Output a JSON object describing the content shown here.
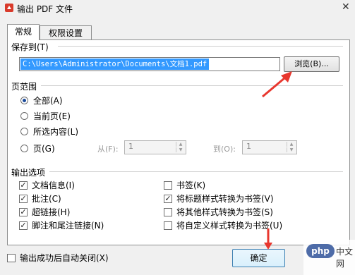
{
  "window": {
    "title": "输出 PDF 文件",
    "icon": "pdf-app-icon"
  },
  "tabs": [
    {
      "label": "常规",
      "active": true
    },
    {
      "label": "权限设置",
      "active": false
    }
  ],
  "save_to": {
    "label": "保存到(T)",
    "path": "C:\\Users\\Administrator\\Documents\\文档1.pdf",
    "browse_label": "浏览(B)..."
  },
  "page_range": {
    "label": "页范围",
    "options": [
      {
        "label": "全部(A)",
        "checked": true
      },
      {
        "label": "当前页(E)",
        "checked": false
      },
      {
        "label": "所选内容(L)",
        "checked": false
      },
      {
        "label": "页(G)",
        "checked": false
      }
    ],
    "from_label": "从(F):",
    "from_value": "1",
    "to_label": "到(O):",
    "to_value": "1"
  },
  "output_options": {
    "label": "输出选项",
    "left": [
      {
        "label": "文档信息(I)",
        "checked": true
      },
      {
        "label": "批注(C)",
        "checked": true
      },
      {
        "label": "超链接(H)",
        "checked": true
      },
      {
        "label": "脚注和尾注链接(N)",
        "checked": true
      }
    ],
    "right": [
      {
        "label": "书签(K)",
        "checked": false
      },
      {
        "label": "将标题样式转换为书签(V)",
        "checked": true
      },
      {
        "label": "将其他样式转换为书签(S)",
        "checked": false
      },
      {
        "label": "将自定义样式转换为书签(U)",
        "checked": false
      }
    ]
  },
  "footer": {
    "auto_close_label": "输出成功后自动关闭(X)",
    "auto_close_checked": false,
    "ok_label": "确定"
  },
  "watermark": {
    "logo": "php",
    "text": "中文网"
  },
  "colors": {
    "selection": "#3399ff",
    "annotation_arrow": "#e8372e"
  }
}
